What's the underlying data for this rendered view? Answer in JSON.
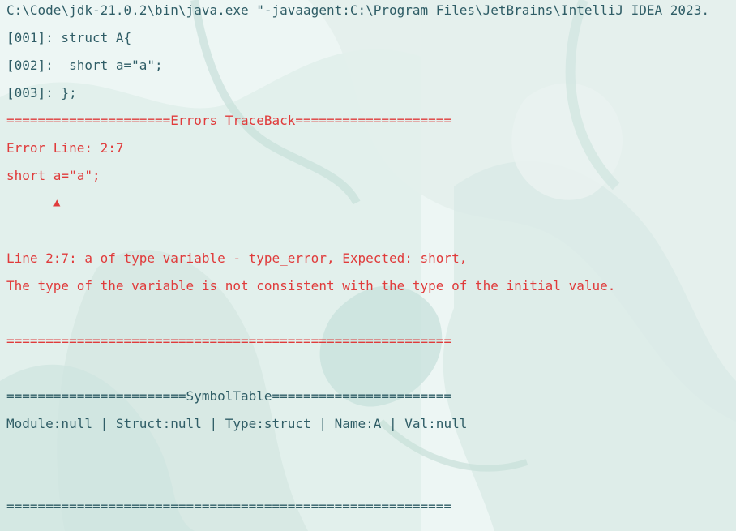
{
  "console": {
    "command": "C:\\Code\\jdk-21.0.2\\bin\\java.exe \"-javaagent:C:\\Program Files\\JetBrains\\IntelliJ IDEA 2023.",
    "source_lines": [
      "[001]: struct A{",
      "[002]:  short a=\"a\";",
      "[003]: };"
    ],
    "errors_header": "=====================Errors TraceBack====================",
    "error_line": "Error Line: 2:7",
    "error_code": "short a=\"a\";",
    "error_caret": "▲",
    "error_message_1": "Line 2:7: a of type variable - type_error, Expected: short,",
    "error_message_2": "The type of the variable is not consistent with the type of the initial value.",
    "errors_footer": "=========================================================",
    "symbol_header": "=======================SymbolTable=======================",
    "symbol_row": "Module:null | Struct:null | Type:struct | Name:A | Val:null",
    "symbol_footer": "========================================================="
  },
  "colors": {
    "normal_text": "#2f5d66",
    "error_text": "#e03b3b",
    "background": "#e8f3f1"
  }
}
